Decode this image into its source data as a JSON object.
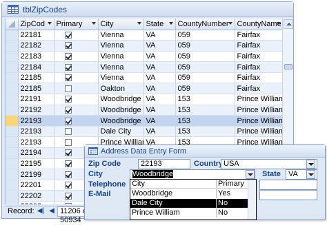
{
  "table_window": {
    "title": "tblZipCodes",
    "columns": [
      "ZipCod",
      "Primary",
      "City",
      "State",
      "CountyNumber",
      "CountyName"
    ],
    "rows": [
      {
        "zip": "22181",
        "primary": true,
        "city": "Vienna",
        "state": "VA",
        "county_number": "059",
        "county_name": "Fairfax"
      },
      {
        "zip": "22182",
        "primary": true,
        "city": "Vienna",
        "state": "VA",
        "county_number": "059",
        "county_name": "Fairfax"
      },
      {
        "zip": "22183",
        "primary": true,
        "city": "Vienna",
        "state": "VA",
        "county_number": "059",
        "county_name": "Fairfax"
      },
      {
        "zip": "22184",
        "primary": true,
        "city": "Vienna",
        "state": "VA",
        "county_number": "059",
        "county_name": "Fairfax"
      },
      {
        "zip": "22185",
        "primary": true,
        "city": "Vienna",
        "state": "VA",
        "county_number": "059",
        "county_name": "Fairfax"
      },
      {
        "zip": "22185",
        "primary": false,
        "city": "Oakton",
        "state": "VA",
        "county_number": "059",
        "county_name": "Fairfax"
      },
      {
        "zip": "22191",
        "primary": true,
        "city": "Woodbridge",
        "state": "VA",
        "county_number": "153",
        "county_name": "Prince William"
      },
      {
        "zip": "22192",
        "primary": true,
        "city": "Woodbridge",
        "state": "VA",
        "county_number": "153",
        "county_name": "Prince William"
      },
      {
        "zip": "22193",
        "primary": true,
        "city": "Woodbridge",
        "state": "VA",
        "county_number": "153",
        "county_name": "Prince William"
      },
      {
        "zip": "22193",
        "primary": false,
        "city": "Dale City",
        "state": "VA",
        "county_number": "153",
        "county_name": "Prince William"
      },
      {
        "zip": "22193",
        "primary": false,
        "city": "Prince William",
        "state": "VA",
        "county_number": "153",
        "county_name": "Prince William"
      },
      {
        "zip": "22194",
        "primary": true,
        "city": "Woodbridge",
        "state": "VA",
        "county_number": "153",
        "county_name": "Prince William"
      },
      {
        "zip": "22195",
        "primary": true,
        "city": "",
        "state": "",
        "county_number": "",
        "county_name": ""
      },
      {
        "zip": "22199",
        "primary": true,
        "city": "",
        "state": "",
        "county_number": "",
        "county_name": ""
      },
      {
        "zip": "22201",
        "primary": true,
        "city": "",
        "state": "",
        "county_number": "",
        "county_name": ""
      },
      {
        "zip": "22202",
        "primary": true,
        "city": "",
        "state": "",
        "county_number": "",
        "county_name": ""
      },
      {
        "zip": "22203",
        "primary": true,
        "city": "",
        "state": "",
        "county_number": "",
        "county_name": ""
      },
      {
        "zip": "22204",
        "primary": true,
        "city": "",
        "state": "",
        "county_number": "",
        "county_name": ""
      }
    ],
    "navigation": {
      "record_label": "Record:",
      "position": "11206 of 50934"
    }
  },
  "form_window": {
    "title": "Address Data Entry Form",
    "zip_label": "Zip Code",
    "zip_value": "22193",
    "country_label": "Country",
    "country_value": "USA",
    "city_label": "City",
    "city_value": "Woodbridge",
    "state_label": "State",
    "state_value": "VA",
    "telephone_label": "Telephone",
    "email_label": "E-Mail",
    "city_dropdown": {
      "headers": [
        "City",
        "Primary"
      ],
      "options": [
        {
          "city": "Woodbridge",
          "primary": "Yes"
        },
        {
          "city": "Dale City",
          "primary": "No"
        },
        {
          "city": "Prince William",
          "primary": "No"
        }
      ],
      "selected_index": 1
    }
  },
  "colors": {
    "window_frame": "#dfe9f6",
    "title_text": "#15428b",
    "alt_row": "#eaf1fa",
    "current_row_selector": "#f9d776"
  },
  "icons": [
    "table-icon",
    "form-icon",
    "dropdown-arrow-icon",
    "checkbox-icon",
    "nav-first-icon",
    "nav-prev-icon",
    "nav-next-icon",
    "nav-last-icon",
    "nav-new-icon"
  ]
}
